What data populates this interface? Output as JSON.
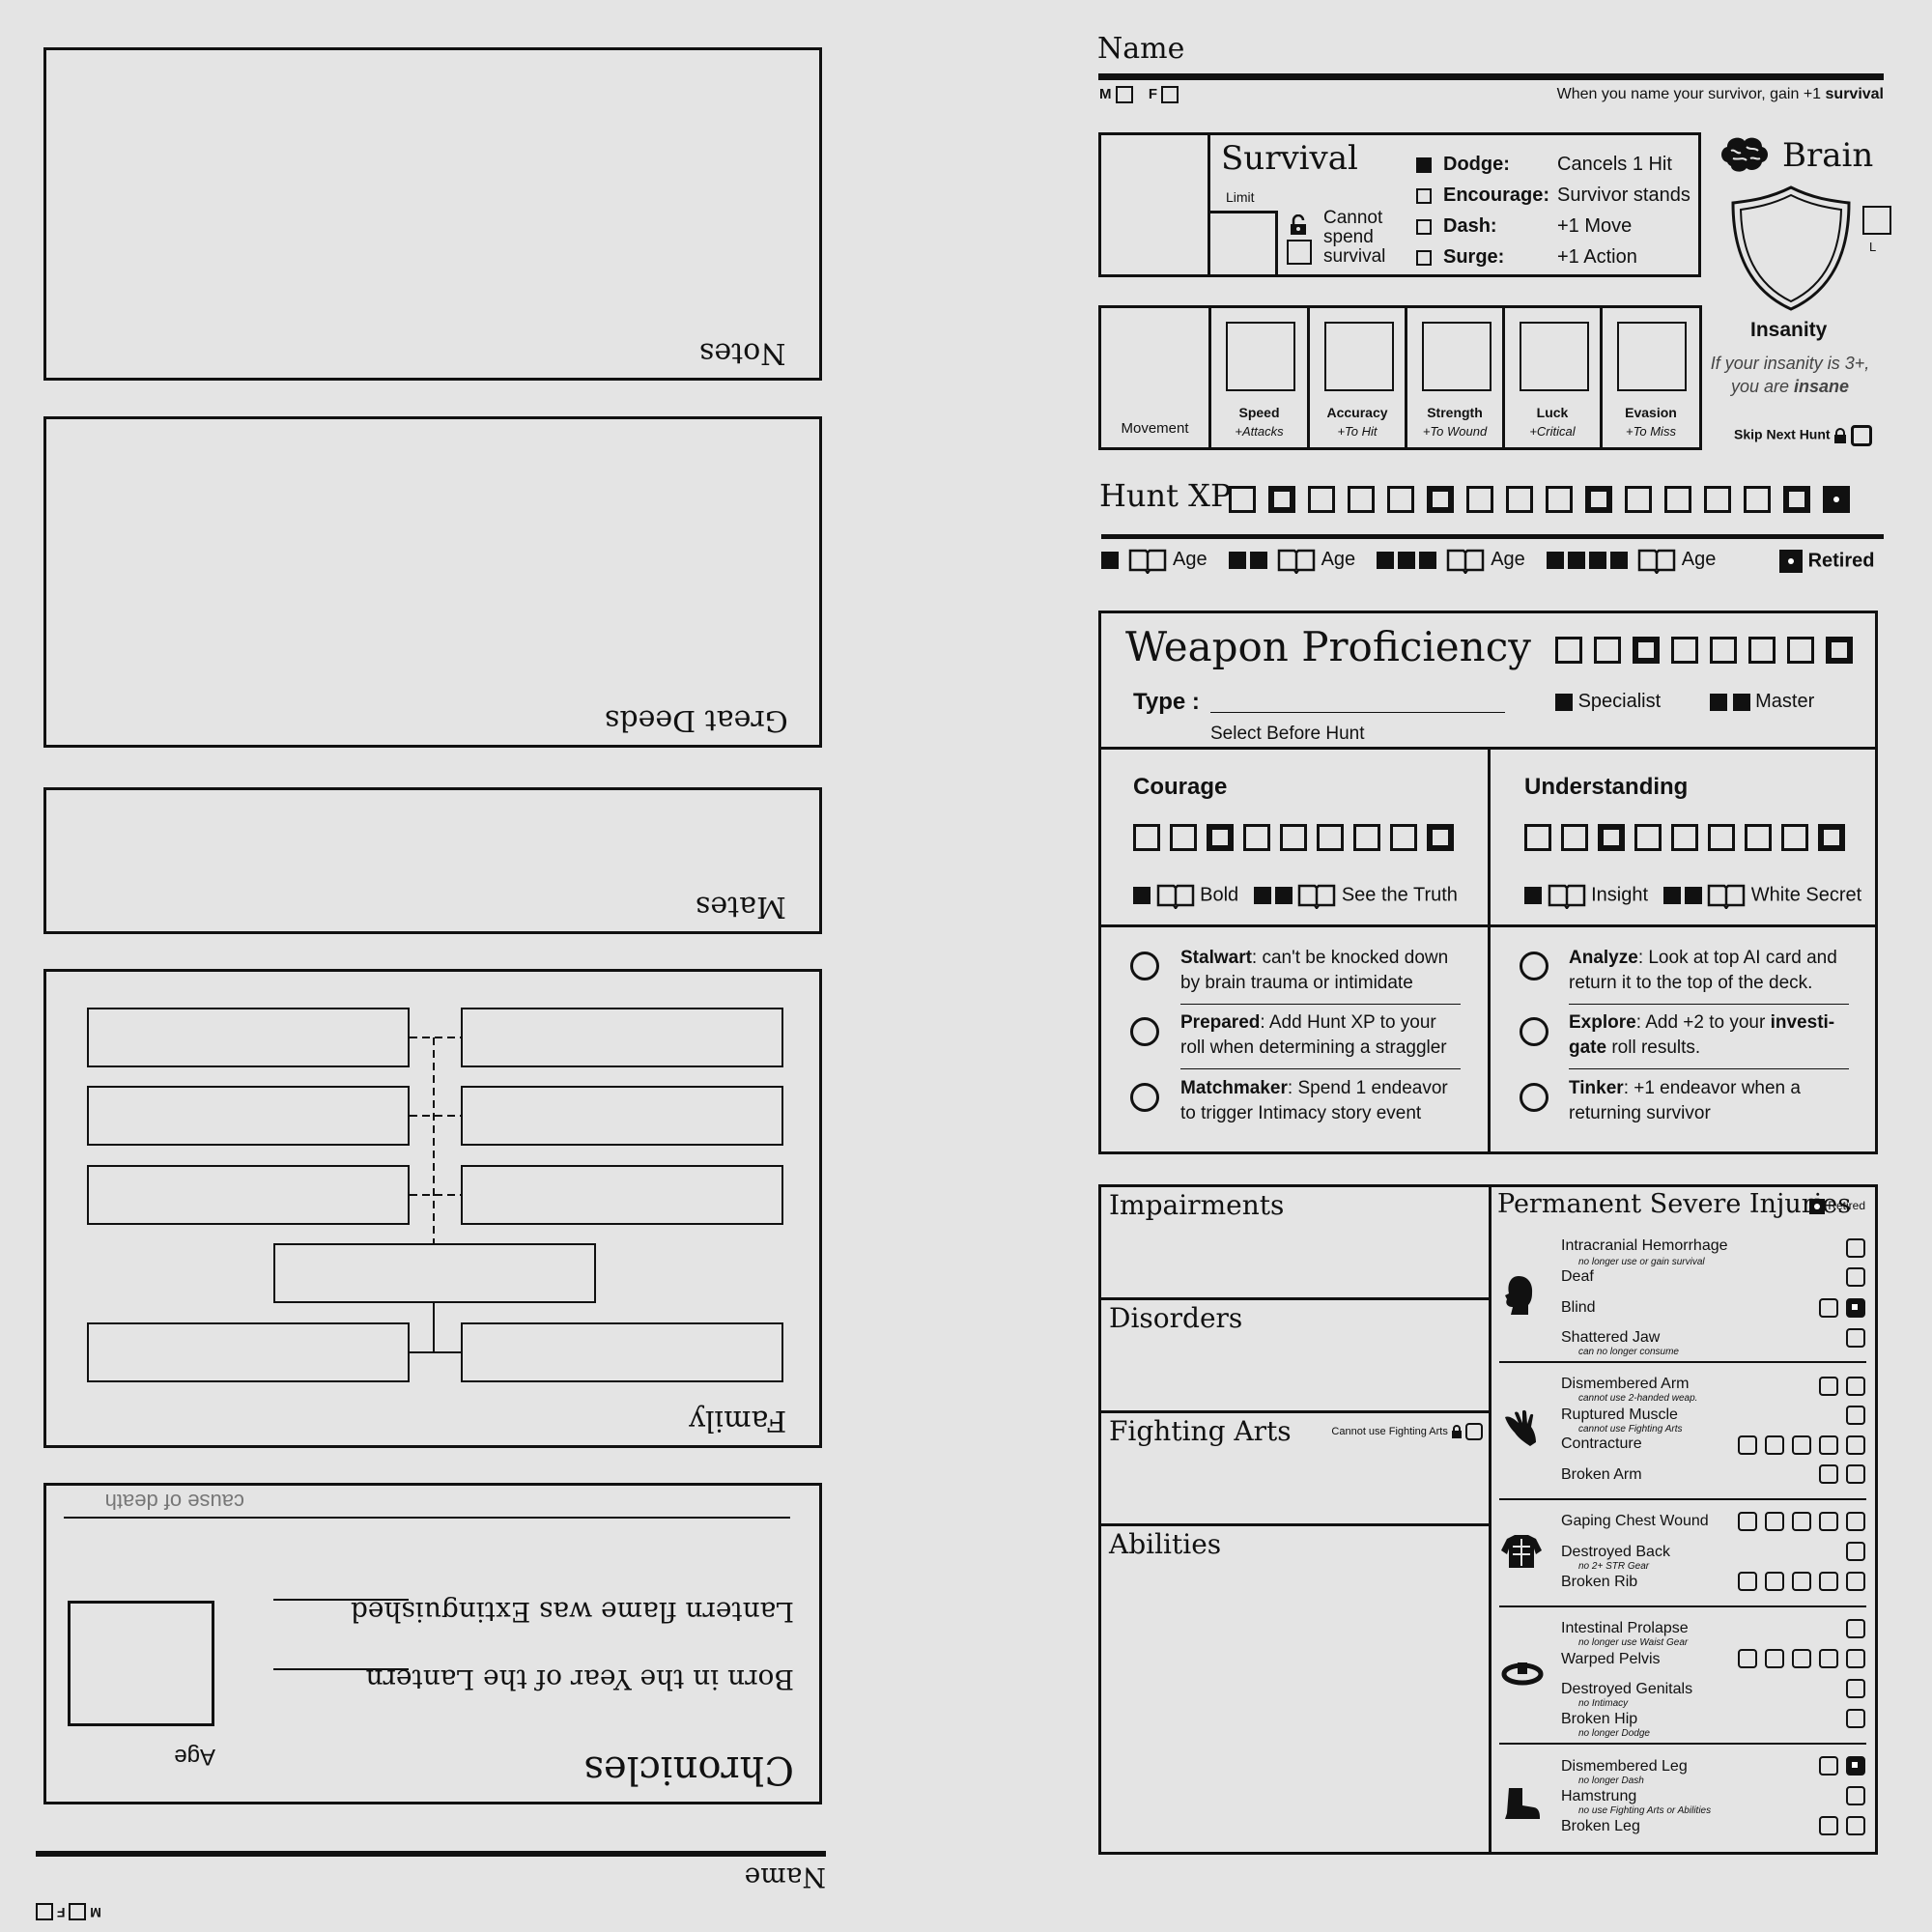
{
  "left": {
    "notes_label": "Notes",
    "great_deeds_label": "Great Deeds",
    "mates_label": "Mates",
    "family_label": "Family",
    "chronicles": {
      "title": "Chronicles",
      "cause_of_death": "cause of death",
      "born_line": "Born in the Year of the Lantern",
      "extinguished_line": "Lantern flame was Extinguished",
      "age_label": "Age"
    },
    "name_label": "Name",
    "m_label": "M",
    "f_label": "F"
  },
  "header": {
    "name_label": "Name",
    "m_label": "M",
    "f_label": "F",
    "name_note_prefix": "When you name your survivor, gain +1 ",
    "name_note_bold": "survival"
  },
  "survival": {
    "title": "Survival",
    "limit_label": "Limit",
    "cannot_spend": [
      "Cannot",
      "spend",
      "survival"
    ],
    "actions": [
      {
        "name": "Dodge:",
        "effect": "Cancels 1 Hit",
        "checked": true
      },
      {
        "name": "Encourage:",
        "effect": "Survivor stands",
        "checked": false
      },
      {
        "name": "Dash:",
        "effect": "+1 Move",
        "checked": false
      },
      {
        "name": "Surge:",
        "effect": "+1 Action",
        "checked": false
      }
    ]
  },
  "brain": {
    "title": "Brain",
    "l_label": "L",
    "insanity_label": "Insanity",
    "insanity_note_1": "If your insanity is 3+,",
    "insanity_note_2_prefix": "you are ",
    "insanity_note_2_bold": "insane",
    "skip_hunt": "Skip Next Hunt"
  },
  "stats": [
    {
      "name": "Movement",
      "sub": ""
    },
    {
      "name": "Speed",
      "sub": "+Attacks"
    },
    {
      "name": "Accuracy",
      "sub": "+To Hit"
    },
    {
      "name": "Strength",
      "sub": "+To Wound"
    },
    {
      "name": "Luck",
      "sub": "+Critical"
    },
    {
      "name": "Evasion",
      "sub": "+To Miss"
    }
  ],
  "hunt_xp": {
    "label": "Hunt XP",
    "boxes": [
      "n",
      "t",
      "n",
      "n",
      "n",
      "t",
      "n",
      "n",
      "n",
      "t",
      "n",
      "n",
      "n",
      "n",
      "t",
      "d"
    ],
    "milestones": [
      {
        "squares": 1,
        "label": "Age"
      },
      {
        "squares": 2,
        "label": "Age"
      },
      {
        "squares": 3,
        "label": "Age"
      },
      {
        "squares": 4,
        "label": "Age"
      }
    ],
    "retired": "Retired"
  },
  "weapon": {
    "title": "Weapon Proficiency",
    "type_label": "Type :",
    "select_note": "Select Before Hunt",
    "boxes": [
      "n",
      "n",
      "t",
      "n",
      "n",
      "n",
      "n",
      "t"
    ],
    "specialist": "Specialist",
    "master": "Master"
  },
  "courage": {
    "title": "Courage",
    "boxes": [
      "n",
      "n",
      "t",
      "n",
      "n",
      "n",
      "n",
      "n",
      "t"
    ],
    "milestone_1": "Bold",
    "milestone_2": "See the Truth",
    "options": [
      {
        "name": "Stalwart",
        "text_1": ": can't be knocked down",
        "text_2": "by brain trauma or intimidate"
      },
      {
        "name": "Prepared",
        "text_1": ": Add Hunt XP to your",
        "text_2": "roll when determining a straggler"
      },
      {
        "name": "Matchmaker",
        "text_1": ": Spend 1 endeavor",
        "text_2": "to trigger Intimacy story event"
      }
    ]
  },
  "understanding": {
    "title": "Understanding",
    "boxes": [
      "n",
      "n",
      "t",
      "n",
      "n",
      "n",
      "n",
      "n",
      "t"
    ],
    "milestone_1": "Insight",
    "milestone_2": "White Secret",
    "options": [
      {
        "name": "Analyze",
        "text_1": ": Look at top AI card and",
        "text_2": "return it to the top of the deck."
      },
      {
        "name": "Explore",
        "text_1": ": Add +2 to your ",
        "text_1b": "investi-",
        "text_2b": "gate",
        "text_2": " roll results."
      },
      {
        "name": "Tinker",
        "text_1": ": +1 endeavor when a",
        "text_2": "returning survivor"
      }
    ]
  },
  "sections": {
    "impairments": "Impairments",
    "disorders": "Disorders",
    "fighting_arts": "Fighting Arts",
    "cannot_use_fa": "Cannot use Fighting Arts",
    "abilities": "Abilities"
  },
  "injuries": {
    "title": "Permanent Severe Injuries",
    "retired": "Retired",
    "head": [
      {
        "name": "Intracranial Hemorrhage",
        "note": "no longer use or gain survival"
      },
      {
        "name": "Deaf",
        "note": ""
      },
      {
        "name": "Blind",
        "note": ""
      },
      {
        "name": "Shattered Jaw",
        "note": "can no longer consume"
      }
    ],
    "arms": [
      {
        "name": "Dismembered Arm",
        "note": "cannot use 2-handed weap."
      },
      {
        "name": "Ruptured Muscle",
        "note": "cannot use Fighting Arts"
      },
      {
        "name": "Contracture",
        "note": ""
      },
      {
        "name": "Broken Arm",
        "note": ""
      }
    ],
    "body": [
      {
        "name": "Gaping Chest Wound",
        "note": ""
      },
      {
        "name": "Destroyed Back",
        "note": "no 2+ STR Gear"
      },
      {
        "name": "Broken Rib",
        "note": ""
      }
    ],
    "waist": [
      {
        "name": "Intestinal Prolapse",
        "note": "no longer use Waist Gear"
      },
      {
        "name": "Warped Pelvis",
        "note": ""
      },
      {
        "name": "Destroyed Genitals",
        "note": "no Intimacy"
      },
      {
        "name": "Broken Hip",
        "note": "no longer Dodge"
      }
    ],
    "legs": [
      {
        "name": "Dismembered Leg",
        "note": "no longer Dash"
      },
      {
        "name": "Hamstrung",
        "note": "no use Fighting Arts or Abilities"
      },
      {
        "name": "Broken Leg",
        "note": ""
      }
    ]
  },
  "colors": {
    "ink": "#111111",
    "paper": "#e4e4e4"
  }
}
